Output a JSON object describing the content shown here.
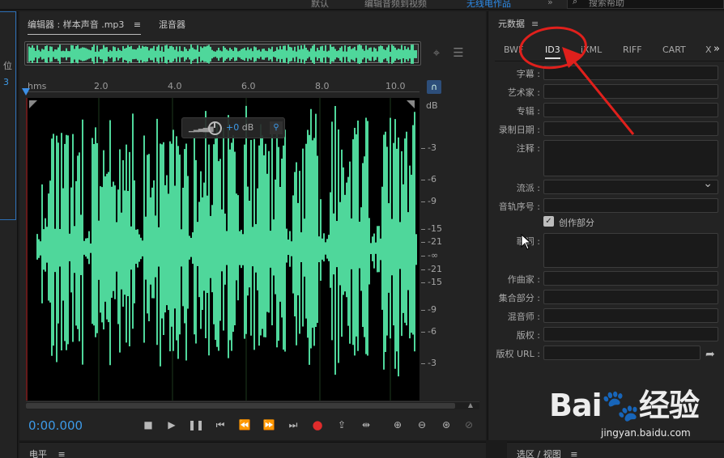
{
  "topbar": {
    "tabs": [
      "默认",
      "编辑音频到视频",
      "无线电作品"
    ],
    "search_placeholder": "搜索帮助"
  },
  "left_panel": {
    "labels": [
      "位",
      "3"
    ]
  },
  "editor": {
    "tab_editor": "编辑器 : 样本声音 .mp3",
    "tab_editor_menu": "≡",
    "tab_mixer": "混音器",
    "ruler_unit": "hms",
    "ruler_ticks": [
      "2.0",
      "4.0",
      "6.0",
      "8.0",
      "10.0"
    ],
    "hud_gain_value": "+0",
    "hud_gain_unit": "dB",
    "db_scale_unit": "dB",
    "db_scale_labels": [
      "-3",
      "-6",
      "-9",
      "-15",
      "-21",
      "-∞",
      "-21",
      "-15",
      "-9",
      "-6",
      "-3"
    ],
    "timecode": "0:00.000",
    "wave_color": "#4fd79b",
    "accent_color": "#3d9ae8"
  },
  "metadata": {
    "title": "元数据",
    "menu_icon": "≡",
    "tabs": [
      "BWF",
      "ID3",
      "iXML",
      "RIFF",
      "CART",
      "X"
    ],
    "active_tab": "ID3",
    "fields": {
      "subtitle": "字幕 :",
      "artist": "艺术家 :",
      "album": "专辑 :",
      "record_date": "录制日期 :",
      "comment": "注释 :",
      "genre": "流派 :",
      "track_number": "音轨序号 :",
      "compilation": "创作部分",
      "lyrics": "歌词 :",
      "composer": "作曲家 :",
      "part_of_set": "集合部分 :",
      "mixer": "混音师 :",
      "copyright": "版权 :",
      "copyright_url": "版权 URL :"
    }
  },
  "bottom": {
    "left_title": "电平",
    "right_title": "选区 / 视图",
    "menu_icon": "≡"
  },
  "watermark": {
    "logo": "Bai🐾经验",
    "url": "jingyan.baidu.com"
  },
  "annotation_color": "#e0201c"
}
